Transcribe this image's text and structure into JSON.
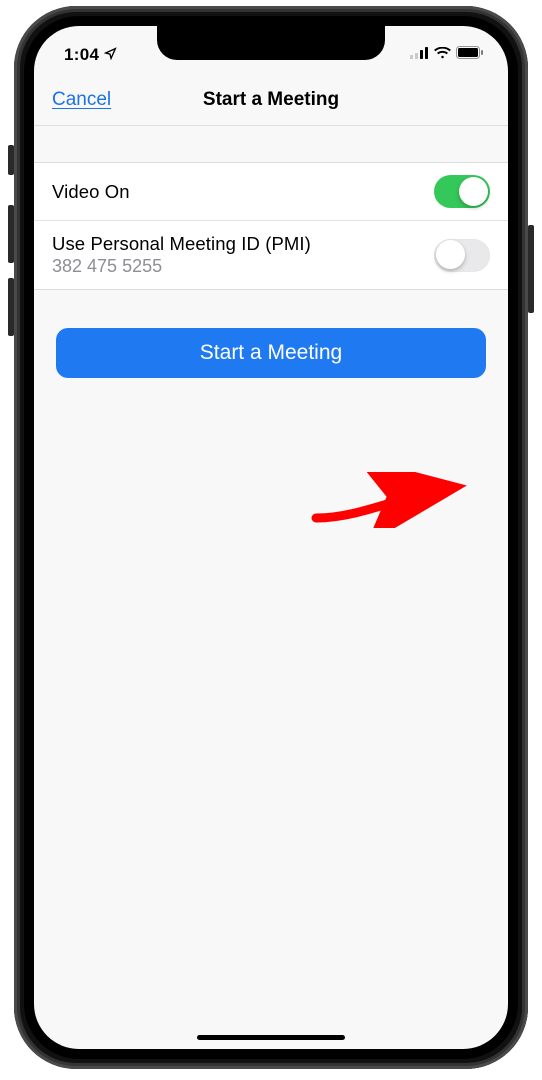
{
  "statusBar": {
    "time": "1:04"
  },
  "nav": {
    "cancel": "Cancel",
    "title": "Start a Meeting"
  },
  "settings": {
    "videoOn": {
      "label": "Video On",
      "value": true
    },
    "pmi": {
      "label": "Use Personal Meeting ID (PMI)",
      "sub": "382 475 5255",
      "value": false
    }
  },
  "action": {
    "start": "Start a Meeting"
  }
}
